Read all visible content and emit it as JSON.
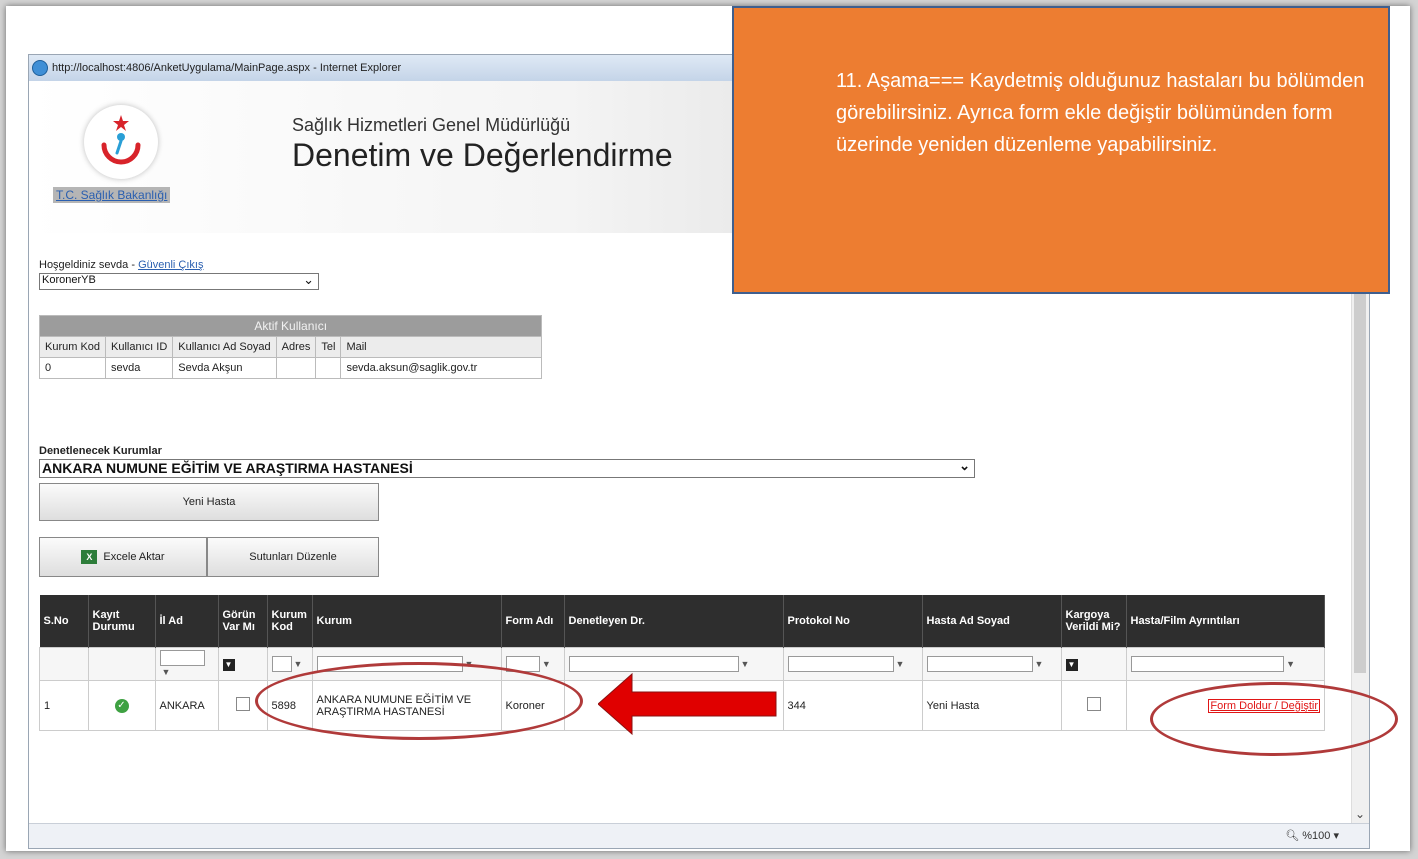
{
  "browser": {
    "title": "http://localhost:4806/AnketUygulama/MainPage.aspx - Internet Explorer",
    "zoom": "%100"
  },
  "header": {
    "ministry_link": "T.C. Sağlık Bakanlığı",
    "line1": "Sağlık Hizmetleri Genel Müdürlüğü",
    "line2": "Denetim ve Değerlendirme"
  },
  "welcome": {
    "text": "Hoşgeldiniz sevda - ",
    "logout": "Güvenli Çıkış"
  },
  "role_select": {
    "value": "KoronerYB"
  },
  "user_table": {
    "caption": "Aktif Kullanıcı",
    "headers": [
      "Kurum Kod",
      "Kullanıcı ID",
      "Kullanıcı Ad Soyad",
      "Adres",
      "Tel",
      "Mail"
    ],
    "row": [
      "0",
      "sevda",
      "Sevda Akşun",
      "",
      "",
      "sevda.aksun@saglik.gov.tr"
    ]
  },
  "institutions": {
    "label": "Denetlenecek Kurumlar",
    "selected": "ANKARA NUMUNE EĞİTİM VE ARAŞTIRMA HASTANESİ"
  },
  "buttons": {
    "new_patient": "Yeni Hasta",
    "export_excel": "Excele Aktar",
    "edit_columns": "Sutunları Düzenle"
  },
  "grid": {
    "headers": [
      "S.No",
      "Kayıt Durumu",
      "İl Ad",
      "Görün Var Mı",
      "Kurum Kod",
      "Kurum",
      "Form Adı",
      "Denetleyen Dr.",
      "Protokol No",
      "Hasta Ad Soyad",
      "Kargoya Verildi Mi?",
      "Hasta/Film Ayrıntıları"
    ],
    "row": {
      "sno": "1",
      "il": "ANKARA",
      "kurum_kod": "5898",
      "kurum": "ANKARA NUMUNE EĞİTİM VE ARAŞTIRMA HASTANESİ",
      "form": "Koroner",
      "doctor": "",
      "protocol": "344",
      "patient": "Yeni Hasta",
      "action": "Form Doldur / Değiştir"
    }
  },
  "callout": {
    "text": "11. Aşama=== Kaydetmiş olduğunuz hastaları bu bölümden görebilirsiniz. Ayrıca form ekle değiştir bölümünden form üzerinde yeniden düzenleme yapabilirsiniz."
  },
  "colors": {
    "callout": "#ed7d31",
    "annotation": "#b03a3a",
    "arrow": "#e00000"
  }
}
